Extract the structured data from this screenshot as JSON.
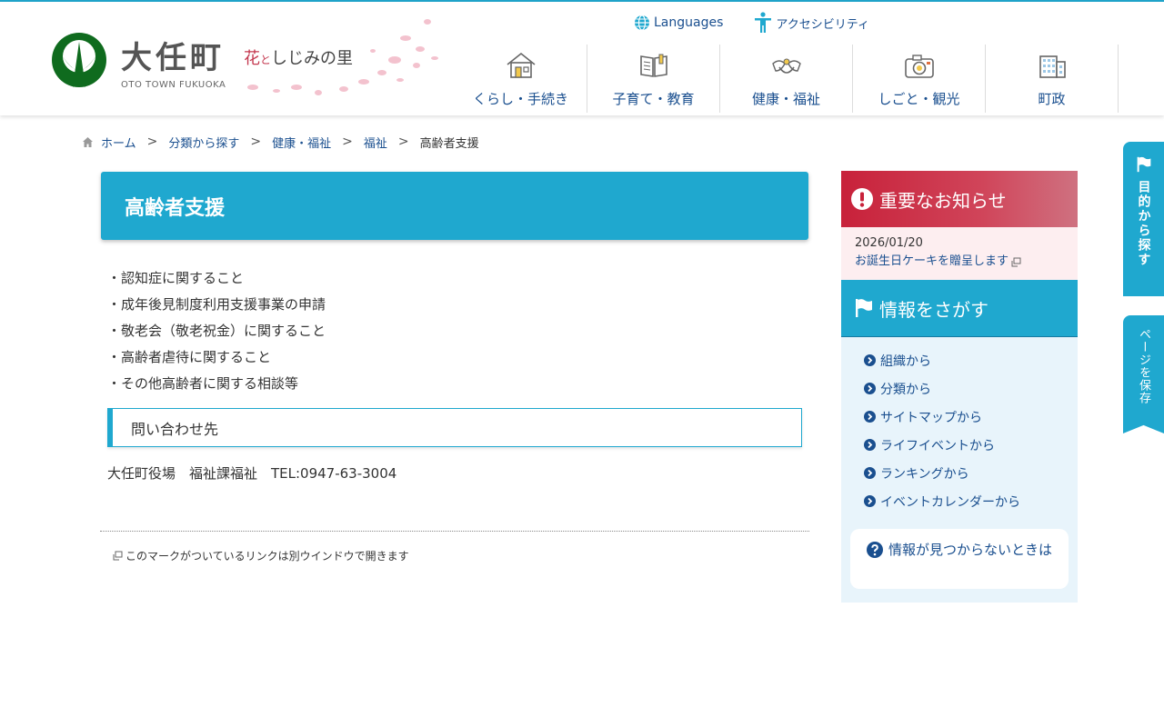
{
  "header": {
    "site_name": "大任町",
    "site_sub": "OTO TOWN FUKUOKA",
    "tagline_hana": "花",
    "tagline_to": "と",
    "tagline_rest": "しじみの里",
    "languages_label": "Languages",
    "accessibility_label": "アクセシビリティ"
  },
  "gnav": {
    "items": [
      {
        "label": "くらし・手続き",
        "icon": "house-icon"
      },
      {
        "label": "子育て・教育",
        "icon": "book-icon"
      },
      {
        "label": "健康・福祉",
        "icon": "hands-icon"
      },
      {
        "label": "しごと・観光",
        "icon": "camera-icon"
      },
      {
        "label": "町政",
        "icon": "building-icon"
      }
    ]
  },
  "breadcrumb": {
    "home": "ホーム",
    "items": [
      "分類から探す",
      "健康・福祉",
      "福祉"
    ],
    "separator": ">",
    "current": "高齢者支援"
  },
  "main": {
    "title": "高齢者支援",
    "list": [
      "・認知症に関すること",
      "・成年後見制度利用支援事業の申請",
      "・敬老会（敬老祝金）に関すること",
      "・高齢者虐待に関すること",
      "・その他高齢者に関する相談等"
    ],
    "contact_heading": "問い合わせ先",
    "contact_body": "大任町役場　福祉課福祉　TEL:0947-63-3004",
    "note": "このマークがついているリンクは別ウインドウで開きます"
  },
  "sidebar": {
    "important_title": "重要なお知らせ",
    "important_date": "2026/01/20",
    "important_link": "お誕生日ケーキを贈呈します",
    "search_title": "情報をさがす",
    "search_items": [
      "組織から",
      "分類から",
      "サイトマップから",
      "ライフイベントから",
      "ランキングから",
      "イベントカレンダーから"
    ],
    "not_found": "情報が見つからないときは"
  },
  "side_tabs": {
    "purpose": "目的から探す",
    "save": "ページを保存"
  },
  "colors": {
    "accent": "#1fa8cf",
    "link": "#1a4f8f",
    "important": "#c8213a",
    "logo_green": "#0f6b1e"
  }
}
